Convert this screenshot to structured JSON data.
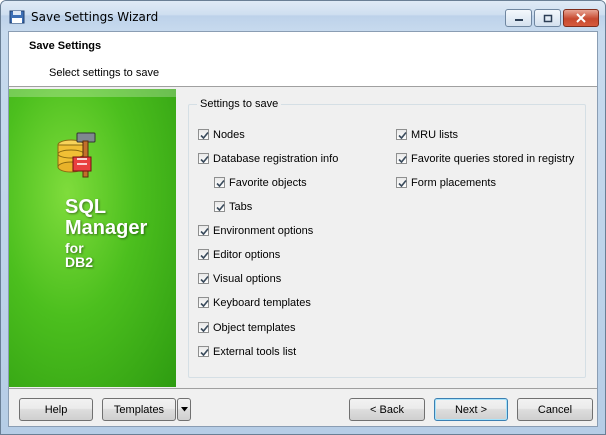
{
  "window": {
    "title": "Save Settings Wizard"
  },
  "header": {
    "title": "Save Settings",
    "subtitle": "Select settings to save"
  },
  "banner": {
    "line1": "SQL",
    "line2": "Manager",
    "line3": "for",
    "line4": "DB2"
  },
  "settings": {
    "legend": "Settings to save",
    "left": [
      {
        "label": "Nodes",
        "checked": true
      },
      {
        "label": "Database registration info",
        "checked": true
      },
      {
        "label": "Favorite objects",
        "checked": true
      },
      {
        "label": "Tabs",
        "checked": true
      },
      {
        "label": "Environment options",
        "checked": true
      },
      {
        "label": "Editor options",
        "checked": true
      },
      {
        "label": "Visual options",
        "checked": true
      },
      {
        "label": "Keyboard templates",
        "checked": true
      },
      {
        "label": "Object templates",
        "checked": true
      },
      {
        "label": "External tools list",
        "checked": true
      }
    ],
    "right": [
      {
        "label": "MRU lists",
        "checked": true
      },
      {
        "label": "Favorite queries stored in registry",
        "checked": true
      },
      {
        "label": "Form placements",
        "checked": true
      }
    ]
  },
  "buttons": {
    "help": "Help",
    "templates": "Templates",
    "back": "< Back",
    "next": "Next >",
    "cancel": "Cancel"
  },
  "colors": {
    "banner_green": "#4cbf1e",
    "accent_blue": "#3c7fb1",
    "close_red": "#c7492f"
  }
}
